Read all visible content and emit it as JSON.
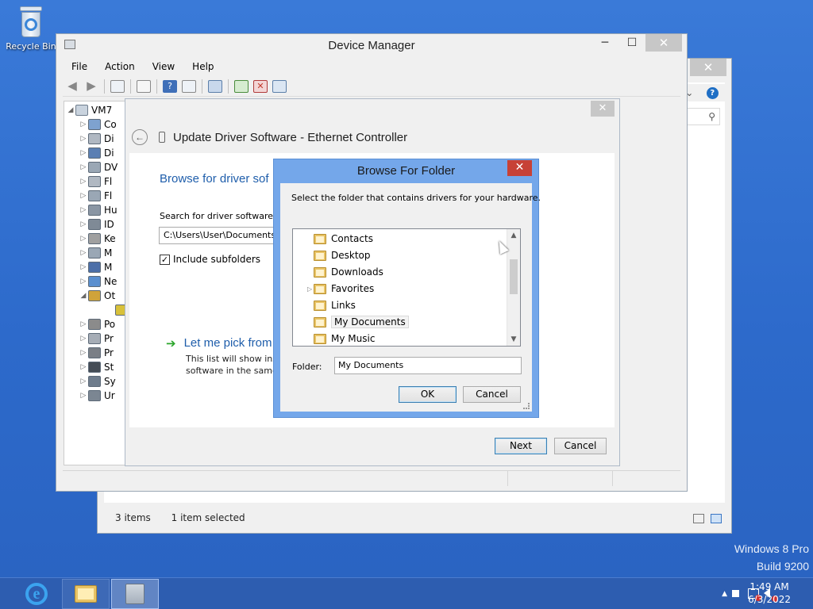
{
  "desktop": {
    "recycle_bin_label": "Recycle Bin",
    "watermark_line1": "Windows 8 Pro",
    "watermark_line2": "Build 9200"
  },
  "explorer_window": {
    "status_items": "3 items",
    "status_selected": "1 item selected"
  },
  "device_manager": {
    "title": "Device Manager",
    "menu": [
      "File",
      "Action",
      "View",
      "Help"
    ],
    "tree_root": "VM7",
    "tree_items": [
      "Co",
      "Di",
      "Di",
      "DV",
      "Fl",
      "Fl",
      "Hu",
      "ID",
      "Ke",
      "M",
      "M",
      "Ne",
      "Ot",
      "",
      "Po",
      "Pr",
      "Pr",
      "St",
      "Sy",
      "Ur"
    ]
  },
  "update_driver": {
    "title": "Update Driver Software - Ethernet Controller",
    "heading": "Browse for driver sof",
    "search_label": "Search for driver software in",
    "path_value": "C:\\Users\\User\\Documents",
    "include_subfolders": "Include subfolders",
    "pick_title": "Let me pick from",
    "pick_desc_line1": "This list will show inst",
    "pick_desc_line2": "software in the same",
    "next": "Next",
    "cancel": "Cancel"
  },
  "browse_folder": {
    "title": "Browse For Folder",
    "instruction": "Select the folder that contains drivers for your hardware.",
    "folders": [
      "Contacts",
      "Desktop",
      "Downloads",
      "Favorites",
      "Links",
      "My Documents",
      "My Music"
    ],
    "selected": "My Documents",
    "folder_label": "Folder:",
    "folder_value": "My Documents",
    "ok": "OK",
    "cancel": "Cancel"
  },
  "taskbar": {
    "time": "1:49 AM",
    "date": "6/3/2022"
  },
  "colors": {
    "desktop": "#2d6acb",
    "taskbar": "#2d5db0",
    "dialog_frame": "#74a7ea",
    "close_red": "#c74136",
    "link_blue": "#1f5eab"
  }
}
